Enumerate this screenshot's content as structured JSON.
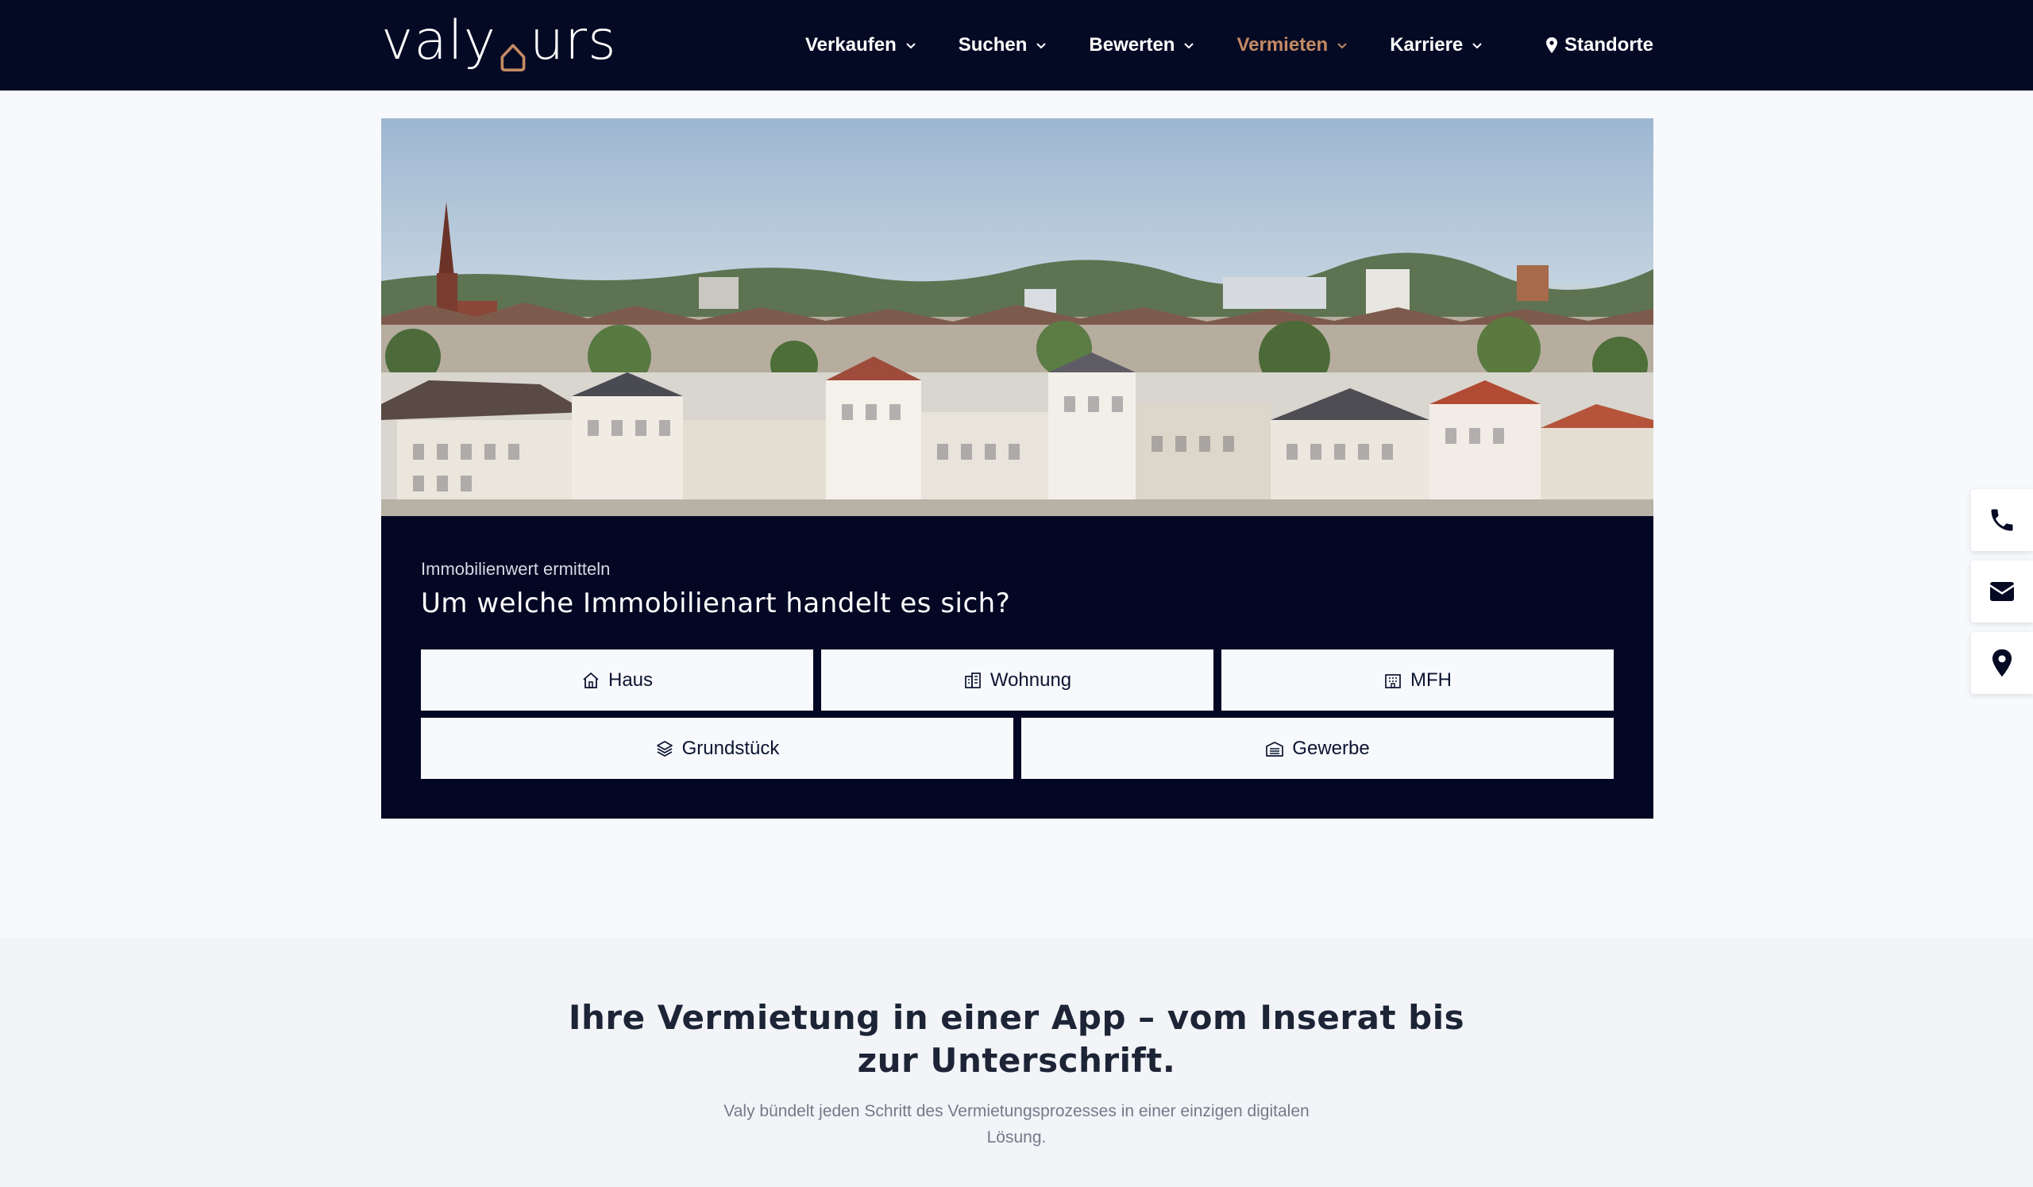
{
  "header": {
    "logo": "valyours",
    "nav": [
      {
        "label": "Verkaufen",
        "active": false
      },
      {
        "label": "Suchen",
        "active": false
      },
      {
        "label": "Bewerten",
        "active": false
      },
      {
        "label": "Vermieten",
        "active": true
      },
      {
        "label": "Karriere",
        "active": false
      }
    ],
    "locations_label": "Standorte"
  },
  "hero": {
    "image": "city-skyline-photo"
  },
  "valuation": {
    "kicker": "Immobilienwert ermitteln",
    "question": "Um welche Immobilienart handelt es sich?",
    "options": [
      {
        "label": "Haus",
        "icon": "house-icon"
      },
      {
        "label": "Wohnung",
        "icon": "apartment-building-icon"
      },
      {
        "label": "MFH",
        "icon": "multi-family-building-icon"
      },
      {
        "label": "Grundstück",
        "icon": "layers-icon"
      },
      {
        "label": "Gewerbe",
        "icon": "warehouse-icon"
      }
    ]
  },
  "side_contact": [
    "phone-icon",
    "envelope-icon",
    "location-pin-icon"
  ],
  "section": {
    "title": "Ihre Vermietung in einer App – vom Inserat bis zur Unterschrift.",
    "subtitle": "Valy bündelt jeden Schritt des Vermietungsprozesses in einer einzigen digitalen Lösung."
  },
  "colors": {
    "navy": "#050a24",
    "accent": "#c48a64",
    "panel": "#030723",
    "background": "#f7f9fc"
  }
}
